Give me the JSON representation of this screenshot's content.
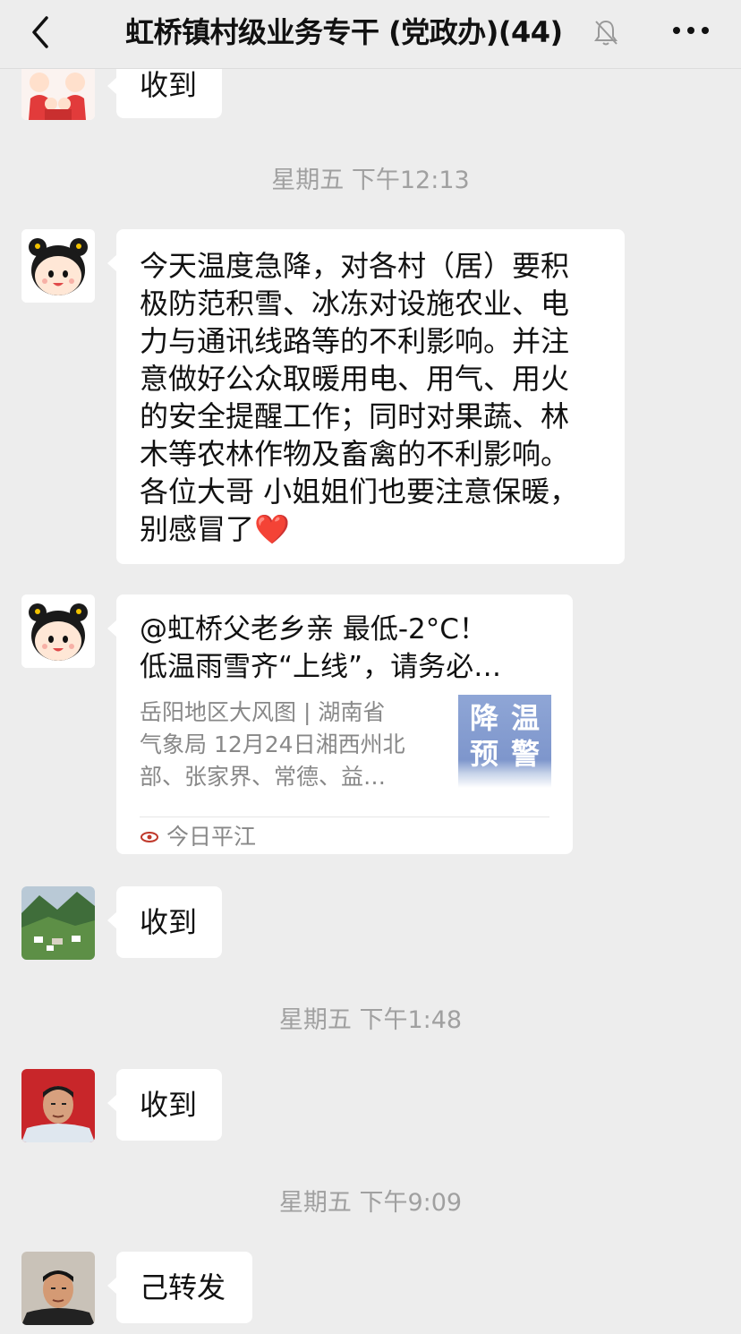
{
  "header": {
    "title": "虹桥镇村级业务专干 (党政办)(44)",
    "back_icon": "chevron-left-icon",
    "mute_icon": "bell-off-icon",
    "more_icon": "more-dots-icon"
  },
  "messages": [
    {
      "avatar": "family-cartoon-avatar",
      "text": "收到"
    },
    {
      "time": "星期五 下午12:13"
    },
    {
      "avatar": "cartoon-girl-avatar",
      "text": "今天温度急降，对各村（居）要积\n极防范积雪、冰冻对设施农业、电\n力与通讯线路等的不利影响。并注\n意做好公众取暖用电、用气、用火\n的安全提醒工作；同时对果蔬、林\n木等农林作物及畜禽的不利影响。\n各位大哥 小姐姐们也要注意保暖，\n别感冒了",
      "emoji": "❤️"
    },
    {
      "avatar": "cartoon-girl-avatar",
      "card": {
        "title": "@虹桥父老乡亲  最低-2°C！\n低温雨雪齐“上线”，请务必…",
        "desc": "岳阳地区大风图 | 湖南省\n气象局 12月24日湘西州北\n部、张家界、常德、益…",
        "thumb_chars": [
          "降",
          "温",
          "预",
          "警"
        ],
        "source": "今日平江"
      }
    },
    {
      "avatar": "landscape-avatar",
      "text": "收到"
    },
    {
      "time": "星期五 下午1:48"
    },
    {
      "avatar": "man-photo-avatar",
      "text": "收到"
    },
    {
      "time": "星期五 下午9:09"
    },
    {
      "avatar": "man-photo-avatar",
      "text": "己转发"
    }
  ]
}
